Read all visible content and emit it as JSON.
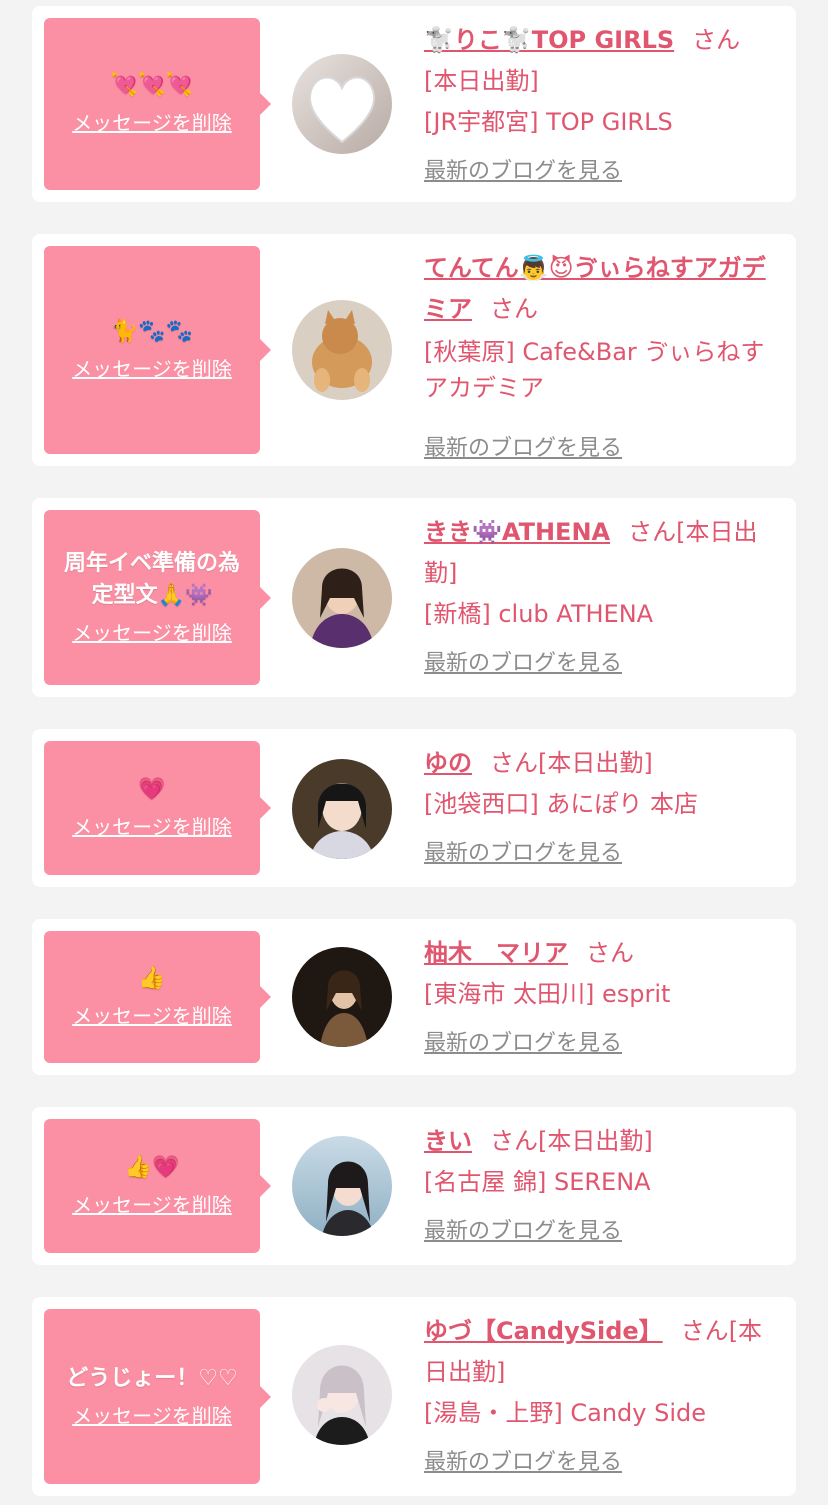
{
  "delete_label": "メッセージを削除",
  "blog_label": "最新のブログを見る",
  "san_label": "さん",
  "cards": [
    {
      "message": "💘💘💘",
      "name": "🐩りこ🐩TOP GIRLS",
      "status": "",
      "shop": "[本日出勤]\n[JR宇都宮] TOP GIRLS"
    },
    {
      "message": "🐈🐾🐾",
      "name": "てんてん👼😈ゔぃらねすアガデミア",
      "status": "",
      "shop": "[秋葉原] Cafe&Bar ゔぃらねすアカデミア"
    },
    {
      "message": "周年イベ準備の為定型文🙏👾",
      "name": "きき👾ATHENA",
      "status": "[本日出勤]",
      "shop": "[新橋] club ATHENA"
    },
    {
      "message": "💗",
      "name": "ゆの",
      "status": "[本日出勤]",
      "shop": "[池袋西口] あにぽり 本店"
    },
    {
      "message": "👍",
      "name": "柚木　マリア",
      "status": "",
      "shop": "[東海市 太田川] esprit"
    },
    {
      "message": "👍💗",
      "name": "きい",
      "status": "[本日出勤]",
      "shop": "[名古屋 錦] SERENA"
    },
    {
      "message": "どうじょー！♡♡",
      "name": "ゆづ【CandySide】",
      "status": "[本日出勤]",
      "shop": "[湯島・上野] Candy Side"
    }
  ]
}
